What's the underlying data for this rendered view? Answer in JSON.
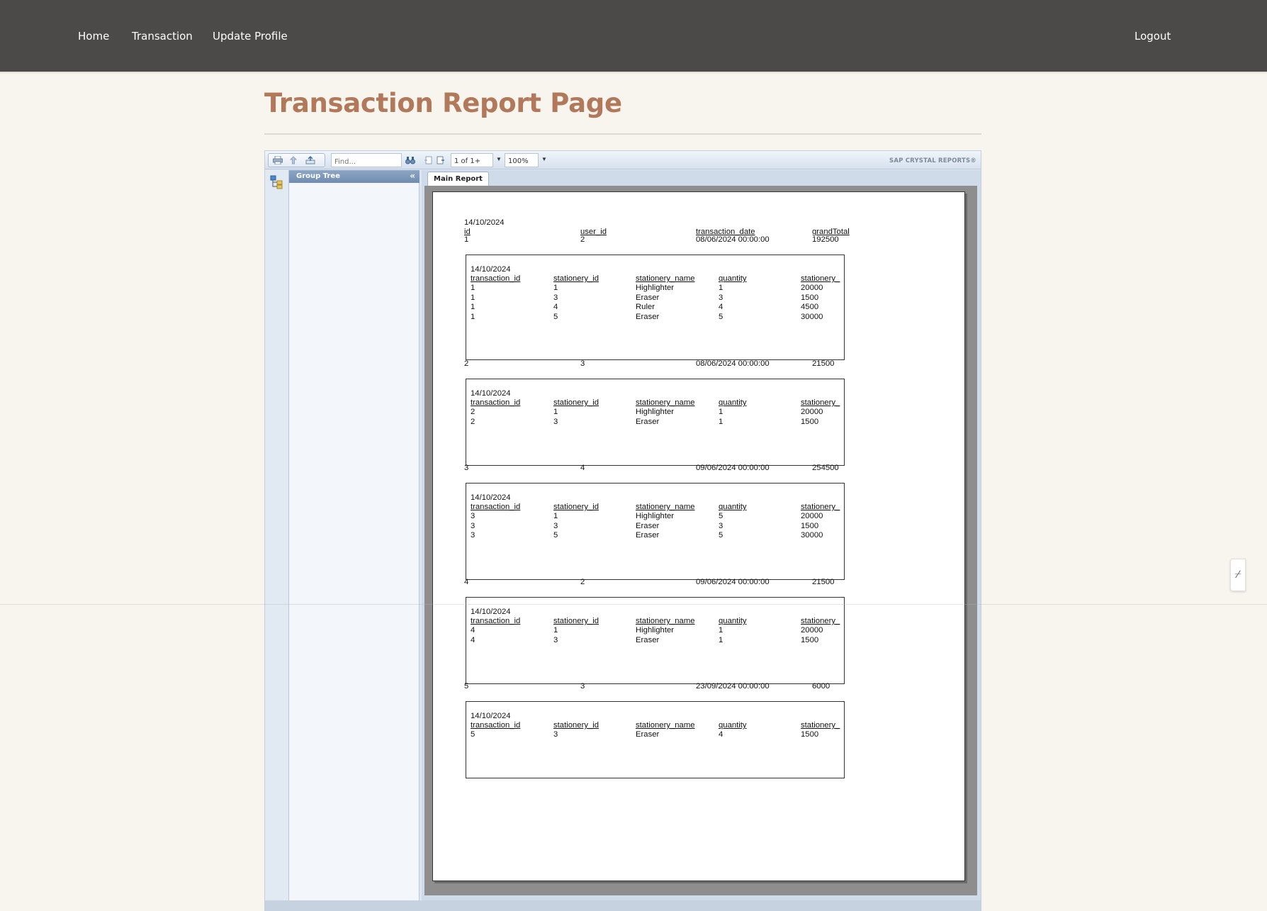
{
  "nav": {
    "items": [
      "Home",
      "Transaction",
      "Update Profile"
    ],
    "logout": "Logout"
  },
  "page": {
    "title": "Transaction Report Page"
  },
  "viewer": {
    "find_placeholder": "Find...",
    "page_indicator": "1 of 1+",
    "zoom": "100%",
    "brand": "SAP CRYSTAL REPORTS®",
    "group_tree_label": "Group Tree",
    "main_tab": "Main Report"
  },
  "report": {
    "date": "14/10/2024",
    "headers": {
      "id": "id",
      "user_id": "user_id",
      "transaction_date": "transaction_date",
      "grand_total": "grandTotal"
    },
    "sub_headers": {
      "transaction_id": "transaction_id",
      "stationery_id": "stationery_id",
      "stationery_name": "stationery_name",
      "quantity": "quantity",
      "price": "stationery_"
    },
    "transactions": [
      {
        "id": "1",
        "user_id": "2",
        "date": "08/06/2024 00:00:00",
        "grand_total": "192500",
        "sub_date": "14/10/2024",
        "details": [
          {
            "tid": "1",
            "sid": "1",
            "name": "Highlighter",
            "qty": "1",
            "price": "20000"
          },
          {
            "tid": "1",
            "sid": "3",
            "name": "Eraser",
            "qty": "3",
            "price": "1500"
          },
          {
            "tid": "1",
            "sid": "4",
            "name": "Ruler",
            "qty": "4",
            "price": "4500"
          },
          {
            "tid": "1",
            "sid": "5",
            "name": "Eraser",
            "qty": "5",
            "price": "30000"
          }
        ]
      },
      {
        "id": "2",
        "user_id": "3",
        "date": "08/06/2024 00:00:00",
        "grand_total": "21500",
        "sub_date": "14/10/2024",
        "details": [
          {
            "tid": "2",
            "sid": "1",
            "name": "Highlighter",
            "qty": "1",
            "price": "20000"
          },
          {
            "tid": "2",
            "sid": "3",
            "name": "Eraser",
            "qty": "1",
            "price": "1500"
          }
        ]
      },
      {
        "id": "3",
        "user_id": "4",
        "date": "09/06/2024 00:00:00",
        "grand_total": "254500",
        "sub_date": "14/10/2024",
        "details": [
          {
            "tid": "3",
            "sid": "1",
            "name": "Highlighter",
            "qty": "5",
            "price": "20000"
          },
          {
            "tid": "3",
            "sid": "3",
            "name": "Eraser",
            "qty": "3",
            "price": "1500"
          },
          {
            "tid": "3",
            "sid": "5",
            "name": "Eraser",
            "qty": "5",
            "price": "30000"
          }
        ]
      },
      {
        "id": "4",
        "user_id": "2",
        "date": "09/06/2024 00:00:00",
        "grand_total": "21500",
        "sub_date": "14/10/2024",
        "details": [
          {
            "tid": "4",
            "sid": "1",
            "name": "Highlighter",
            "qty": "1",
            "price": "20000"
          },
          {
            "tid": "4",
            "sid": "3",
            "name": "Eraser",
            "qty": "1",
            "price": "1500"
          }
        ]
      },
      {
        "id": "5",
        "user_id": "3",
        "date": "23/09/2024 00:00:00",
        "grand_total": "6000",
        "sub_date": "14/10/2024",
        "details": [
          {
            "tid": "5",
            "sid": "3",
            "name": "Eraser",
            "qty": "4",
            "price": "1500"
          }
        ]
      }
    ]
  },
  "handle_icon": "collapse-handle-icon"
}
